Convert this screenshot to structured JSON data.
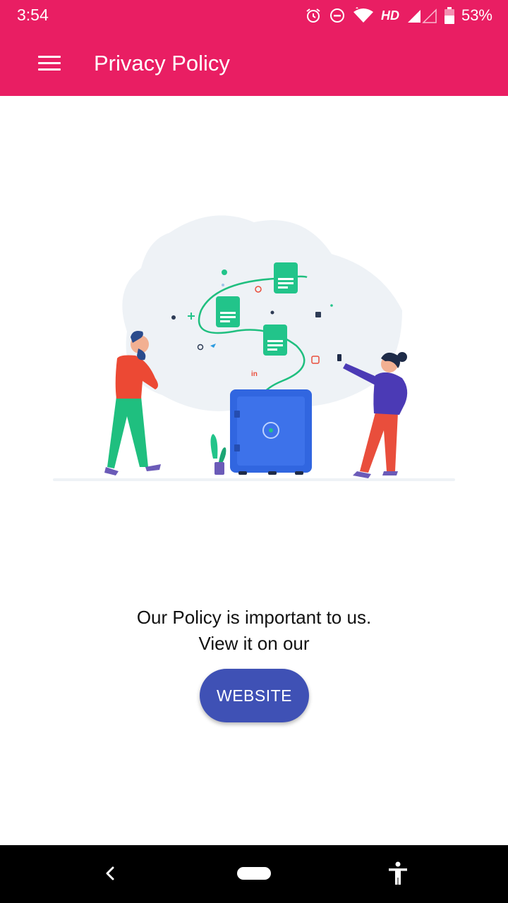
{
  "status_bar": {
    "time": "3:54",
    "network_label": "HD",
    "battery": "53%",
    "icons": [
      "alarm-icon",
      "do-not-disturb-icon",
      "wifi-icon",
      "signal-icon",
      "battery-icon"
    ]
  },
  "toolbar": {
    "title": "Privacy Policy",
    "menu_icon": "hamburger-menu-icon"
  },
  "illustration": {
    "description_icon": "privacy-safe-illustration"
  },
  "content": {
    "line1": "Our Policy is important to us.",
    "line2": "View it on our",
    "button_label": "WEBSITE"
  },
  "colors": {
    "primary": "#e91e63",
    "accent": "#3f51b5"
  },
  "nav_bar": {
    "icons": [
      "back-icon",
      "home-pill-icon",
      "accessibility-icon"
    ]
  }
}
